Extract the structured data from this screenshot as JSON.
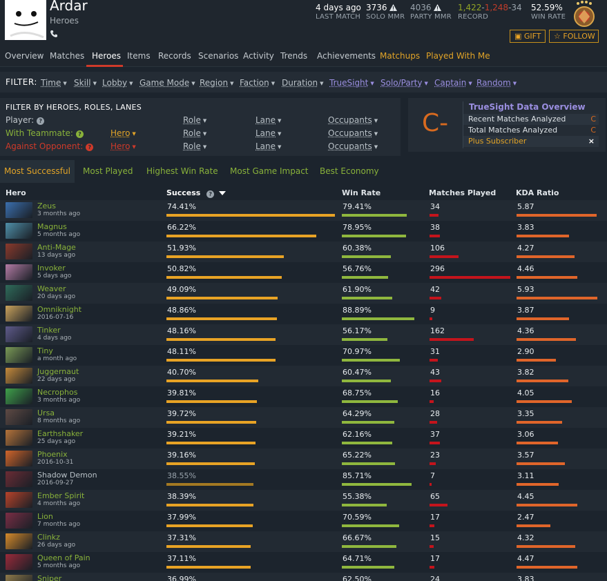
{
  "player": {
    "name": "Ardar",
    "subtitle": "Heroes",
    "phone_icon": "phone-icon"
  },
  "stats": {
    "last_match_value": "4 days ago",
    "last_match_label": "LAST MATCH",
    "solo_mmr_value": "3736",
    "solo_mmr_label": "SOLO MMR",
    "party_mmr_value": "4036",
    "party_mmr_label": "PARTY MMR",
    "record_wins": "1,422",
    "record_losses": "1,248",
    "record_abandons": "34",
    "record_sep": "-",
    "record_label": "RECORD",
    "win_rate_value": "52.59%",
    "win_rate_label": "WIN RATE"
  },
  "header_buttons": {
    "gift_label": "GIFT",
    "follow_label": "FOLLOW"
  },
  "nav": {
    "items": [
      "Overview",
      "Matches",
      "Heroes",
      "Items",
      "Records",
      "Scenarios",
      "Activity",
      "Trends",
      "Achievements",
      "Matchups",
      "Played With Me"
    ],
    "active": "Heroes"
  },
  "filter": {
    "label": "FILTER:",
    "items": [
      "Time",
      "Skill",
      "Lobby",
      "Game Mode",
      "Region",
      "Faction",
      "Duration",
      "TrueSight",
      "Solo/Party",
      "Captain",
      "Random"
    ]
  },
  "hero_filter": {
    "title": "FILTER BY HEROES, ROLES, LANES",
    "player_label": "Player:",
    "teammate_label": "With Teammate:",
    "opponent_label": "Against Opponent:",
    "hero": "Hero",
    "role": "Role",
    "lane": "Lane",
    "occupants": "Occupants"
  },
  "truesight": {
    "grade": "C-",
    "title": "TrueSight Data Overview",
    "recent_label": "Recent Matches Analyzed",
    "recent_value": "C",
    "total_label": "Total Matches Analyzed",
    "total_value": "C",
    "plus_label": "Plus Subscriber",
    "close_glyph": "×"
  },
  "tabs": {
    "items": [
      "Most Successful",
      "Most Played",
      "Highest Win Rate",
      "Most Game Impact",
      "Best Economy"
    ],
    "active": "Most Successful"
  },
  "table": {
    "headers": {
      "hero": "Hero",
      "success": "Success",
      "win_rate": "Win Rate",
      "matches": "Matches Played",
      "kda": "KDA Ratio"
    },
    "rows": [
      {
        "hero": "Zeus",
        "when": "3 months ago",
        "success": "74.41%",
        "success_v": 74.41,
        "win_rate": "79.41%",
        "win_v": 79.41,
        "matches": "34",
        "matches_v": 34,
        "kda": "5.87",
        "kda_v": 5.87,
        "color": "#3b6fae"
      },
      {
        "hero": "Magnus",
        "when": "5 months ago",
        "success": "66.22%",
        "success_v": 66.22,
        "win_rate": "78.95%",
        "win_v": 78.95,
        "matches": "38",
        "matches_v": 38,
        "kda": "3.83",
        "kda_v": 3.83,
        "color": "#4f8fa8"
      },
      {
        "hero": "Anti-Mage",
        "when": "13 days ago",
        "success": "51.93%",
        "success_v": 51.93,
        "win_rate": "60.38%",
        "win_v": 60.38,
        "matches": "106",
        "matches_v": 106,
        "kda": "4.27",
        "kda_v": 4.27,
        "color": "#8a3a2c"
      },
      {
        "hero": "Invoker",
        "when": "5 days ago",
        "success": "50.82%",
        "success_v": 50.82,
        "win_rate": "56.76%",
        "win_v": 56.76,
        "matches": "296",
        "matches_v": 296,
        "kda": "4.46",
        "kda_v": 4.46,
        "color": "#b37ba4"
      },
      {
        "hero": "Weaver",
        "when": "20 days ago",
        "success": "49.09%",
        "success_v": 49.09,
        "win_rate": "61.90%",
        "win_v": 61.9,
        "matches": "42",
        "matches_v": 42,
        "kda": "5.93",
        "kda_v": 5.93,
        "color": "#2f6b5a"
      },
      {
        "hero": "Omniknight",
        "when": "2016-07-16",
        "success": "48.86%",
        "success_v": 48.86,
        "win_rate": "88.89%",
        "win_v": 88.89,
        "matches": "9",
        "matches_v": 9,
        "kda": "3.87",
        "kda_v": 3.87,
        "color": "#c9a25c"
      },
      {
        "hero": "Tinker",
        "when": "4 days ago",
        "success": "48.16%",
        "success_v": 48.16,
        "win_rate": "56.17%",
        "win_v": 56.17,
        "matches": "162",
        "matches_v": 162,
        "kda": "4.36",
        "kda_v": 4.36,
        "color": "#5e5a8a"
      },
      {
        "hero": "Tiny",
        "when": "a month ago",
        "success": "48.11%",
        "success_v": 48.11,
        "win_rate": "70.97%",
        "win_v": 70.97,
        "matches": "31",
        "matches_v": 31,
        "kda": "2.90",
        "kda_v": 2.9,
        "color": "#7a9a56"
      },
      {
        "hero": "Juggernaut",
        "when": "22 days ago",
        "success": "40.70%",
        "success_v": 40.7,
        "win_rate": "60.47%",
        "win_v": 60.47,
        "matches": "43",
        "matches_v": 43,
        "kda": "3.82",
        "kda_v": 3.82,
        "color": "#c58a3b"
      },
      {
        "hero": "Necrophos",
        "when": "3 months ago",
        "success": "39.81%",
        "success_v": 39.81,
        "win_rate": "68.75%",
        "win_v": 68.75,
        "matches": "16",
        "matches_v": 16,
        "kda": "4.05",
        "kda_v": 4.05,
        "color": "#3fa04a"
      },
      {
        "hero": "Ursa",
        "when": "8 months ago",
        "success": "39.72%",
        "success_v": 39.72,
        "win_rate": "64.29%",
        "win_v": 64.29,
        "matches": "28",
        "matches_v": 28,
        "kda": "3.35",
        "kda_v": 3.35,
        "color": "#5e4a44"
      },
      {
        "hero": "Earthshaker",
        "when": "25 days ago",
        "success": "39.21%",
        "success_v": 39.21,
        "win_rate": "62.16%",
        "win_v": 62.16,
        "matches": "37",
        "matches_v": 37,
        "kda": "3.06",
        "kda_v": 3.06,
        "color": "#b5733a"
      },
      {
        "hero": "Phoenix",
        "when": "2016-10-31",
        "success": "39.16%",
        "success_v": 39.16,
        "win_rate": "65.22%",
        "win_v": 65.22,
        "matches": "23",
        "matches_v": 23,
        "kda": "3.57",
        "kda_v": 3.57,
        "color": "#d2652a"
      },
      {
        "hero": "Shadow Demon",
        "when": "2016-09-27",
        "success": "38.55%",
        "success_v": 38.55,
        "win_rate": "85.71%",
        "win_v": 85.71,
        "matches": "7",
        "matches_v": 7,
        "kda": "3.11",
        "kda_v": 3.11,
        "color": "#6b2c35",
        "dim": true
      },
      {
        "hero": "Ember Spirit",
        "when": "4 months ago",
        "success": "38.39%",
        "success_v": 38.39,
        "win_rate": "55.38%",
        "win_v": 55.38,
        "matches": "65",
        "matches_v": 65,
        "kda": "4.45",
        "kda_v": 4.45,
        "color": "#b8432a"
      },
      {
        "hero": "Lion",
        "when": "7 months ago",
        "success": "37.99%",
        "success_v": 37.99,
        "win_rate": "70.59%",
        "win_v": 70.59,
        "matches": "17",
        "matches_v": 17,
        "kda": "2.47",
        "kda_v": 2.47,
        "color": "#7a2e45"
      },
      {
        "hero": "Clinkz",
        "when": "26 days ago",
        "success": "37.31%",
        "success_v": 37.31,
        "win_rate": "66.67%",
        "win_v": 66.67,
        "matches": "15",
        "matches_v": 15,
        "kda": "4.32",
        "kda_v": 4.32,
        "color": "#d58a2a"
      },
      {
        "hero": "Queen of Pain",
        "when": "5 months ago",
        "success": "37.11%",
        "success_v": 37.11,
        "win_rate": "64.71%",
        "win_v": 64.71,
        "matches": "17",
        "matches_v": 17,
        "kda": "4.47",
        "kda_v": 4.47,
        "color": "#9a2a3a"
      },
      {
        "hero": "Sniper",
        "when": "",
        "success": "36.99%",
        "success_v": 36.99,
        "win_rate": "62.50%",
        "win_v": 62.5,
        "matches": "24",
        "matches_v": 24,
        "kda": "3.83",
        "kda_v": 3.83,
        "color": "#8f7a4a"
      }
    ]
  },
  "colors": {
    "accent_gold": "#e2a427",
    "hero_green": "#89b23a",
    "loss_red": "#c23c2a",
    "truesight_purple": "#9a8ee0",
    "success_bar": "#e8a325",
    "win_bar": "#8fb73e",
    "matches_bar": "#c4141c",
    "kda_bar": "#e0652a"
  }
}
